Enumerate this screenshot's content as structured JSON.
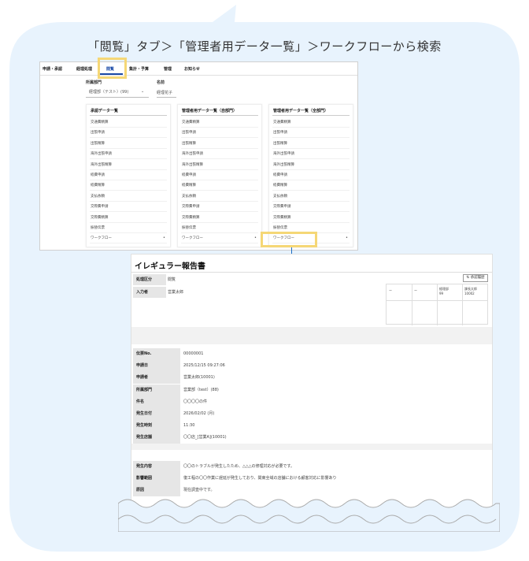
{
  "caption": "「閲覧」タブ＞「管理者用データ一覧」＞ワークフローから検索",
  "menu": [
    "申請・承認",
    "経理処理",
    "閲覧",
    "集計・予算",
    "管理",
    "お知らせ"
  ],
  "filters": {
    "dept_label": "所属部門",
    "dept_value": "経理部（テスト）(99)",
    "name_label": "名前",
    "name_value": "経理花子"
  },
  "columns": [
    {
      "title": "承認データ一覧",
      "items": [
        "交通費精算",
        "出張申請",
        "出張精算",
        "海外出張申請",
        "海外出張精算",
        "経費申請",
        "経費精算",
        "支払依頼",
        "交際費申請",
        "交際費精算",
        "振替伝票",
        "ワークフロー"
      ]
    },
    {
      "title": "管理者用データ一覧（自部門）",
      "items": [
        "交通費精算",
        "出張申請",
        "出張精算",
        "海外出張申請",
        "海外出張精算",
        "経費申請",
        "経費精算",
        "支払依頼",
        "交際費申請",
        "交際費精算",
        "振替伝票",
        "ワークフロー"
      ]
    },
    {
      "title": "管理者用データ一覧（全部門）",
      "items": [
        "交通費精算",
        "出張申請",
        "出張精算",
        "海外出張申請",
        "海外出張精算",
        "経費申請",
        "経費精算",
        "支払依頼",
        "交際費申請",
        "交際費精算",
        "振替伝票",
        "ワークフロー"
      ]
    }
  ],
  "report": {
    "title": "イレギュラー報告書",
    "status_label": "処理区分",
    "status_value": "閲覧",
    "input_label": "入力者",
    "input_value": "営業太郎",
    "approve_btn": "承認履歴",
    "approve_table": {
      "c1": "ー",
      "c2": "ー",
      "c3a": "経理部",
      "c3b": "99",
      "c4a": "課長太郎",
      "c4b": "10002"
    },
    "fields1": [
      {
        "label": "伝票No.",
        "value": "00000001"
      },
      {
        "label": "申請日",
        "value": "2025/12/15 09:27:06"
      },
      {
        "label": "申請者",
        "value": "営業太郎(10001)"
      },
      {
        "label": "所属部門",
        "value": "営業部（test）(88)"
      },
      {
        "label": "件名",
        "value": "〇〇〇〇の件"
      },
      {
        "label": "発生日付",
        "value": "2026/02/02 (月)"
      },
      {
        "label": "発生時刻",
        "value": "11:30"
      },
      {
        "label": "発生店舗",
        "value": "〇〇店_[営業A](10001)"
      }
    ],
    "fields2": [
      {
        "label": "発生内容",
        "value": "〇〇のトラブルが発生したため、△△△の修理対応が必要です。"
      },
      {
        "label": "影響範囲",
        "value": "復工程の〇〇作業に遅延が発生しており、関東全域の店舗における顧客対応に影響あり"
      },
      {
        "label": "原因",
        "value": "現在調査中です。"
      }
    ]
  }
}
